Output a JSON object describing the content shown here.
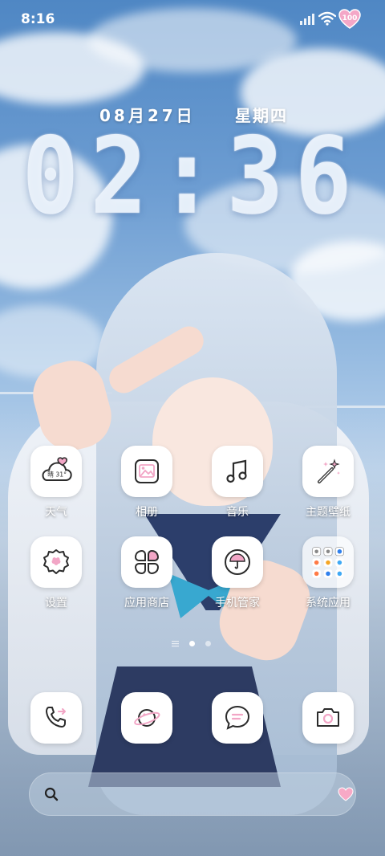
{
  "status_bar": {
    "time": "8:16",
    "battery_label": "100",
    "icons": [
      "signal-icon",
      "wifi-icon",
      "battery-heart-icon"
    ]
  },
  "clock": {
    "date": "08月27日",
    "weekday": "星期四",
    "time": "02:36"
  },
  "apps": [
    {
      "label": "天气",
      "icon": "weather-cloud-icon",
      "badge": "晴 31°"
    },
    {
      "label": "相册",
      "icon": "gallery-icon"
    },
    {
      "label": "音乐",
      "icon": "music-note-icon"
    },
    {
      "label": "主题壁纸",
      "icon": "magic-wand-icon"
    },
    {
      "label": "设置",
      "icon": "gear-icon"
    },
    {
      "label": "应用商店",
      "icon": "app-store-icon"
    },
    {
      "label": "手机管家",
      "icon": "phone-manager-umbrella-icon"
    },
    {
      "label": "系统应用",
      "icon": "folder-icon"
    }
  ],
  "dock": [
    {
      "icon": "phone-icon"
    },
    {
      "icon": "browser-planet-icon"
    },
    {
      "icon": "messages-icon"
    },
    {
      "icon": "camera-icon"
    }
  ],
  "pager": {
    "current_page": 2,
    "total_pages": 3
  },
  "search": {
    "placeholder": ""
  },
  "colors": {
    "accent_pink": "#f2a6c6",
    "icon_line": "#2b2b2b",
    "tile_bg": "#ffffff"
  }
}
